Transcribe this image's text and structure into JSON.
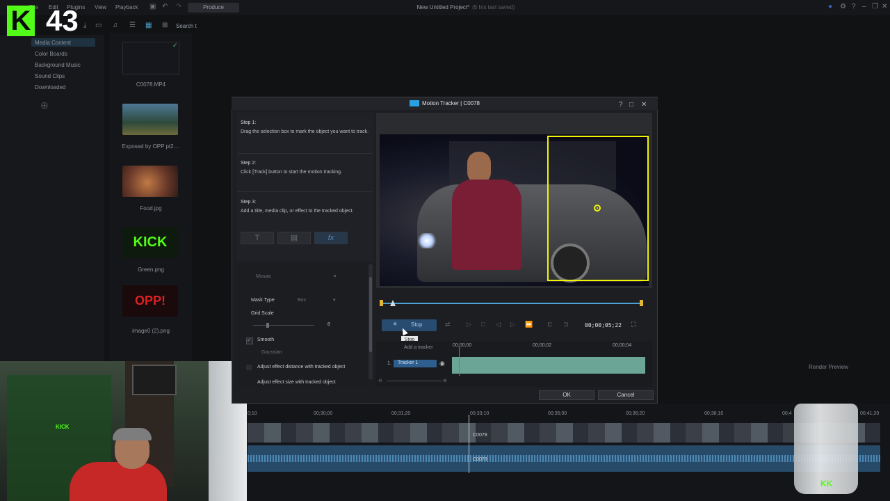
{
  "app": {
    "menu": [
      "File",
      "Edit",
      "Plugins",
      "View",
      "Playback"
    ],
    "produce_label": "Produce",
    "title": "New Untitled Project*",
    "title_sub": "(5 hrs last saved)",
    "search_label": "Search t"
  },
  "library": {
    "items": [
      "Media Content",
      "Color Boards",
      "Background Music",
      "Sound Clips",
      "Downloaded"
    ],
    "media": [
      {
        "caption": "C0078.MP4",
        "color": "#15171c"
      },
      {
        "caption": "Exposed by OPP pt2....",
        "color": "#3c5c6e"
      },
      {
        "caption": "Food.jpg",
        "color": "#6b3a2a"
      },
      {
        "caption": "Green.png",
        "color": "#123c12"
      },
      {
        "caption": "image0 (2).png",
        "color": "#3a1012"
      }
    ],
    "kick_thumb_text": "KICK",
    "opp_thumb_text": "OPP!"
  },
  "overlay": {
    "badge_letter": "K",
    "count": "43",
    "glass_logo": "KK",
    "poster_kick": "KICK",
    "render_preview": "Render Preview"
  },
  "dialog": {
    "title": "Motion Tracker | C0078",
    "help": "?",
    "maximize": "□",
    "close": "✕",
    "steps": [
      {
        "heading": "Step 1:",
        "text": "Drag the selection box to mark the object you want to track."
      },
      {
        "heading": "Step 2:",
        "text": "Click [Track] button to start the motion tracking."
      },
      {
        "heading": "Step 3:",
        "text": "Add a title, media clip, or effect to the tracked object."
      }
    ],
    "add_buttons": [
      "T",
      "▤",
      "fx"
    ],
    "props": {
      "mosaic_label": "Mosaic",
      "mask_type_label": "Mask Type",
      "mask_type_value": "Box",
      "grid_scale_label": "Grid Scale",
      "grid_scale_value": "8",
      "smooth_label": "Smooth",
      "smooth_checked": true,
      "gaussian_value": "Gaussian",
      "adjust_distance": "Adjust effect distance with tracked object",
      "adjust_size": "Adjust effect size with tracked object"
    },
    "stop_label": "Stop",
    "timecode": "00;00;05;22",
    "tooltip": "Stop",
    "add_tracker": "Add a tracker",
    "tracker_num": "1.",
    "tracker_name": "Tracker 1",
    "tl_ticks": [
      "00;00;00",
      "00;00;02",
      "00;00;04"
    ],
    "ok": "OK",
    "cancel": "Cancel"
  },
  "timeline": {
    "ticks": [
      "0;10",
      "00;30;00",
      "00;31;20",
      "00;33;10",
      "00;35;00",
      "00;36;20",
      "00;38;10",
      "00;4",
      "00;41;20"
    ],
    "clip_label": "C0078"
  },
  "colors": {
    "accent": "#2aa0e0",
    "track_box": "#f4f400",
    "kick_green": "#53fc18",
    "tracker_bar": "#6aa596"
  }
}
